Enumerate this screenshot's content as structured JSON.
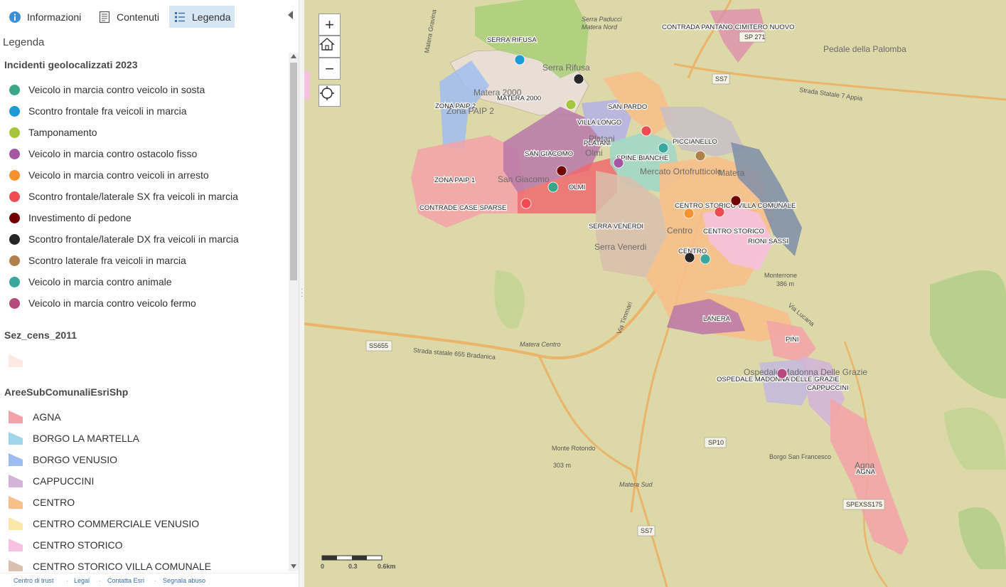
{
  "tabs": [
    {
      "label": "Informazioni",
      "icon": "info-icon"
    },
    {
      "label": "Contenuti",
      "icon": "contents-icon"
    },
    {
      "label": "Legenda",
      "icon": "legend-icon",
      "active": true
    }
  ],
  "panel_title": "Legenda",
  "legend": {
    "incidents": {
      "title": "Incidenti geolocalizzati 2023",
      "items": [
        {
          "label": "Veicolo in marcia contro veicolo in sosta",
          "color": "#3aa78a"
        },
        {
          "label": "Scontro frontale fra veicoli in marcia",
          "color": "#1e9bd7"
        },
        {
          "label": "Tamponamento",
          "color": "#a5c63b"
        },
        {
          "label": "Veicolo in marcia contro ostacolo fisso",
          "color": "#a456a3"
        },
        {
          "label": "Veicolo in marcia contro veicoli in arresto",
          "color": "#f5922f"
        },
        {
          "label": "Scontro frontale/laterale SX fra veicoli in marcia",
          "color": "#ee4b52"
        },
        {
          "label": "Investimento di pedone",
          "color": "#730000"
        },
        {
          "label": "Scontro frontale/laterale DX fra veicoli in marcia",
          "color": "#262626"
        },
        {
          "label": "Scontro laterale fra veicoli in marcia",
          "color": "#b0824b"
        },
        {
          "label": "Veicolo in marcia contro animale",
          "color": "#3aa79c"
        },
        {
          "label": "Veicolo in marcia contro veicolo fermo",
          "color": "#b44b7c"
        }
      ]
    },
    "census": {
      "title": "Sez_cens_2011",
      "color": "#fbe9e2"
    },
    "areas": {
      "title": "AreeSubComunaliEsriShp",
      "items": [
        {
          "label": "AGNA",
          "color": "#f3a3a8"
        },
        {
          "label": "BORGO LA MARTELLA",
          "color": "#9fd6ea"
        },
        {
          "label": "BORGO VENUSIO",
          "color": "#9cbcf2"
        },
        {
          "label": "CAPPUCCINI",
          "color": "#d4b3d8"
        },
        {
          "label": "CENTRO",
          "color": "#f7bf8a"
        },
        {
          "label": "CENTRO COMMERCIALE VENUSIO",
          "color": "#fbe7a6"
        },
        {
          "label": "CENTRO STORICO",
          "color": "#f7c1e2"
        },
        {
          "label": "CENTRO STORICO VILLA COMUNALE",
          "color": "#d9bfad"
        }
      ]
    }
  },
  "footer": [
    "Centro di trust",
    "Legal",
    "Contatta Esri",
    "Segnala abuso"
  ],
  "map": {
    "controls": {
      "zoom_in": "+",
      "zoom_out": "−"
    },
    "scale": {
      "t0": "0",
      "t1": "0.3",
      "t2": "0.6km"
    },
    "area_labels": [
      "SERRA RIFUSA",
      "CONTRADA PANTANO CIMITERO NUOVO",
      "ZONA PAIP 2",
      "MATERA 2000",
      "SAN PARDO",
      "VILLA LONGO",
      "PLATANI",
      "PICCIANELLO",
      "SAN GIACOMO",
      "SPINE BIANCHE",
      "ZONA PAIP 1",
      "OLMI",
      "CONTRADE CASE SPARSE",
      "CENTRO STORICO VILLA COMUNALE",
      "SERRA VENERDI",
      "CENTRO STORICO",
      "RIONI SASSI",
      "CENTRO",
      "LANERA",
      "PINI",
      "OSPEDALE MADONNA DELLE GRAZIE",
      "CAPPUCCINI",
      "AGNA"
    ],
    "place_labels": [
      "Serra Rifusa",
      "Matera 2000",
      "Zona PAIP 2",
      "San Giacomo",
      "Olmi",
      "Platani",
      "Mercato Ortofrutticolo",
      "Centro",
      "Serra Venerdi",
      "Matera",
      "Pedale della Palomba",
      "Ospedale Madonna Delle Grazie",
      "Agna",
      "Borgo San Francesco"
    ],
    "road_labels": [
      "Strada Statale 7 Appia",
      "Strada statale 655 Bradanica",
      "Via Lucana",
      "Via Timmari",
      "Matera Gravina"
    ],
    "sub_labels": [
      "Serra Paducci",
      "Matera Nord",
      "Matera Centro",
      "Matera Sud",
      "Monte Rotondo",
      "303 m",
      "Monterrone",
      "386 m"
    ],
    "shields": [
      "SP 271",
      "SS7",
      "SS655",
      "SP10",
      "SS7",
      "SPEXSS175"
    ]
  }
}
